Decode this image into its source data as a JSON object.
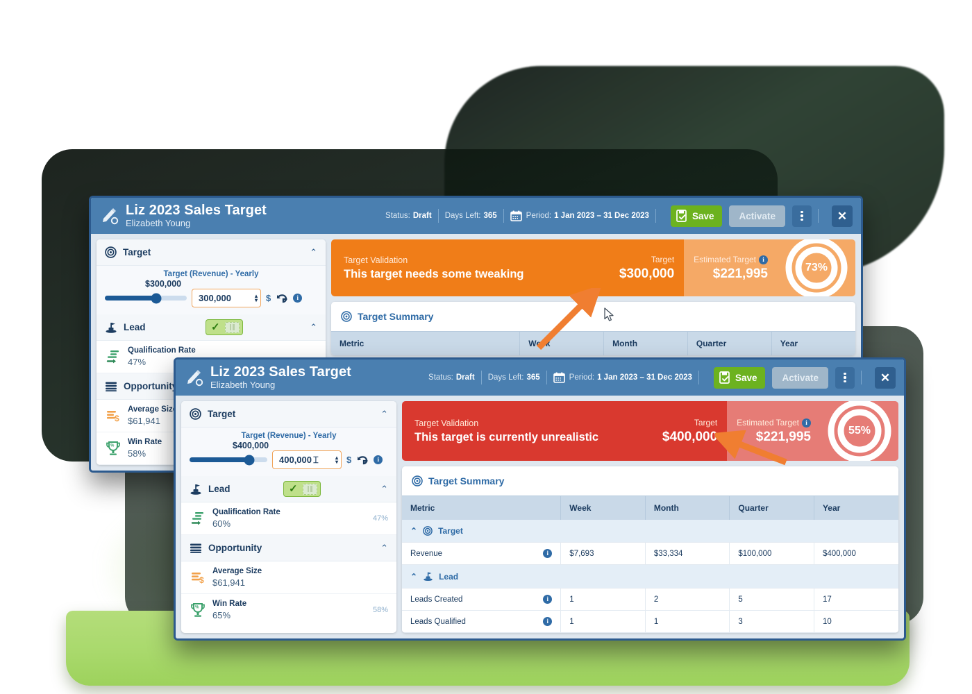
{
  "windows": [
    {
      "id": "back",
      "titlebar": {
        "icon": "pencil-settings-icon",
        "title": "Liz 2023 Sales Target",
        "subtitle": "Elizabeth Young",
        "status_label": "Status:",
        "status_value": "Draft",
        "days_label": "Days Left:",
        "days_value": "365",
        "calendar_icon": "calendar-icon",
        "period_label": "Period:",
        "period_value": "1 Jan 2023 – 31 Dec 2023",
        "save_label": "Save",
        "save_icon": "save-document-icon",
        "activate_label": "Activate",
        "kebab_icon": "more-options-icon",
        "close_icon": "close-icon"
      },
      "sidebar": {
        "target_section": {
          "icon": "target-icon",
          "title": "Target",
          "chevron": "⌃",
          "field_label": "Target (Revenue) - Yearly",
          "slider_value_label": "$300,000",
          "slider_percent": 63,
          "input_value": "300,000",
          "currency": "$",
          "undo_icon": "undo-icon",
          "info_icon": "info-icon"
        },
        "lead_section": {
          "icon": "lead-stamp-icon",
          "title": "Lead",
          "toggle_icon": "check-toggle",
          "chevron": "⌃",
          "metrics": [
            {
              "icon": "qualification-rate-icon",
              "name": "Qualification Rate",
              "value": "47%",
              "right": ""
            }
          ]
        },
        "opportunity_section": {
          "icon": "opportunity-list-icon",
          "title": "Opportunity",
          "chevron": "⌃",
          "metrics": [
            {
              "icon": "average-size-icon",
              "name": "Average Size",
              "value": "$61,941",
              "right": ""
            },
            {
              "icon": "win-rate-icon",
              "name": "Win Rate",
              "value": "58%",
              "right": ""
            }
          ]
        }
      },
      "banner": {
        "variant": "orange",
        "accent": "#f07d18",
        "kicker": "Target Validation",
        "message": "This target needs some tweaking",
        "target_caption": "Target",
        "target_value": "$300,000",
        "estimated_caption": "Estimated Target",
        "estimated_info_icon": "info-icon",
        "estimated_value": "$221,995",
        "percent": "73%"
      },
      "summary": {
        "icon": "target-icon",
        "title": "Target Summary",
        "columns": [
          "Metric",
          "Week",
          "Month",
          "Quarter",
          "Year"
        ],
        "rows": []
      }
    },
    {
      "id": "front",
      "titlebar": {
        "icon": "pencil-settings-icon",
        "title": "Liz 2023 Sales Target",
        "subtitle": "Elizabeth Young",
        "status_label": "Status:",
        "status_value": "Draft",
        "days_label": "Days Left:",
        "days_value": "365",
        "calendar_icon": "calendar-icon",
        "period_label": "Period:",
        "period_value": "1 Jan 2023 – 31 Dec 2023",
        "save_label": "Save",
        "save_icon": "save-document-icon",
        "activate_label": "Activate",
        "kebab_icon": "more-options-icon",
        "close_icon": "close-icon"
      },
      "sidebar": {
        "target_section": {
          "icon": "target-icon",
          "title": "Target",
          "chevron": "⌃",
          "field_label": "Target (Revenue) - Yearly",
          "slider_value_label": "$400,000",
          "slider_percent": 77,
          "input_value": "400,000",
          "currency": "$",
          "undo_icon": "undo-icon",
          "info_icon": "info-icon"
        },
        "lead_section": {
          "icon": "lead-stamp-icon",
          "title": "Lead",
          "toggle_icon": "check-toggle",
          "chevron": "⌃",
          "metrics": [
            {
              "icon": "qualification-rate-icon",
              "name": "Qualification Rate",
              "value": "60%",
              "right": "47%"
            }
          ]
        },
        "opportunity_section": {
          "icon": "opportunity-list-icon",
          "title": "Opportunity",
          "chevron": "⌃",
          "metrics": [
            {
              "icon": "average-size-icon",
              "name": "Average Size",
              "value": "$61,941",
              "right": ""
            },
            {
              "icon": "win-rate-icon",
              "name": "Win Rate",
              "value": "65%",
              "right": "58%"
            }
          ]
        }
      },
      "banner": {
        "variant": "red",
        "accent": "#d9392f",
        "kicker": "Target Validation",
        "message": "This target is currently unrealistic",
        "target_caption": "Target",
        "target_value": "$400,000",
        "estimated_caption": "Estimated Target",
        "estimated_info_icon": "info-icon",
        "estimated_value": "$221,995",
        "percent": "55%"
      },
      "summary": {
        "icon": "target-icon",
        "title": "Target Summary",
        "columns": [
          "Metric",
          "Week",
          "Month",
          "Quarter",
          "Year"
        ],
        "rows": [
          {
            "type": "group",
            "icon": "target-icon",
            "label": "Target",
            "chevron": "⌃"
          },
          {
            "type": "data",
            "metric": "Revenue",
            "info_icon": "info-icon",
            "week": "$7,693",
            "month": "$33,334",
            "quarter": "$100,000",
            "year": "$400,000"
          },
          {
            "type": "group",
            "icon": "lead-stamp-icon",
            "label": "Lead",
            "chevron": "⌃"
          },
          {
            "type": "data",
            "metric": "Leads Created",
            "info_icon": "info-icon",
            "week": "1",
            "month": "2",
            "quarter": "5",
            "year": "17"
          },
          {
            "type": "data",
            "metric": "Leads Qualified",
            "info_icon": "info-icon",
            "week": "1",
            "month": "1",
            "quarter": "3",
            "year": "10"
          }
        ]
      }
    }
  ],
  "annotations": {
    "arrow_color": "#f07e31",
    "arrow_back_name": "callout-arrow-back",
    "arrow_front_name": "callout-arrow-front",
    "cursor_name": "mouse-pointer"
  },
  "colors": {
    "titlebar_blue": "#4a7fb0",
    "window_border": "#2c5a8e",
    "orange_accent": "#f07d18",
    "red_accent": "#d9392f",
    "save_green": "#6cb21f",
    "laptop_green": "#a9d96c"
  }
}
